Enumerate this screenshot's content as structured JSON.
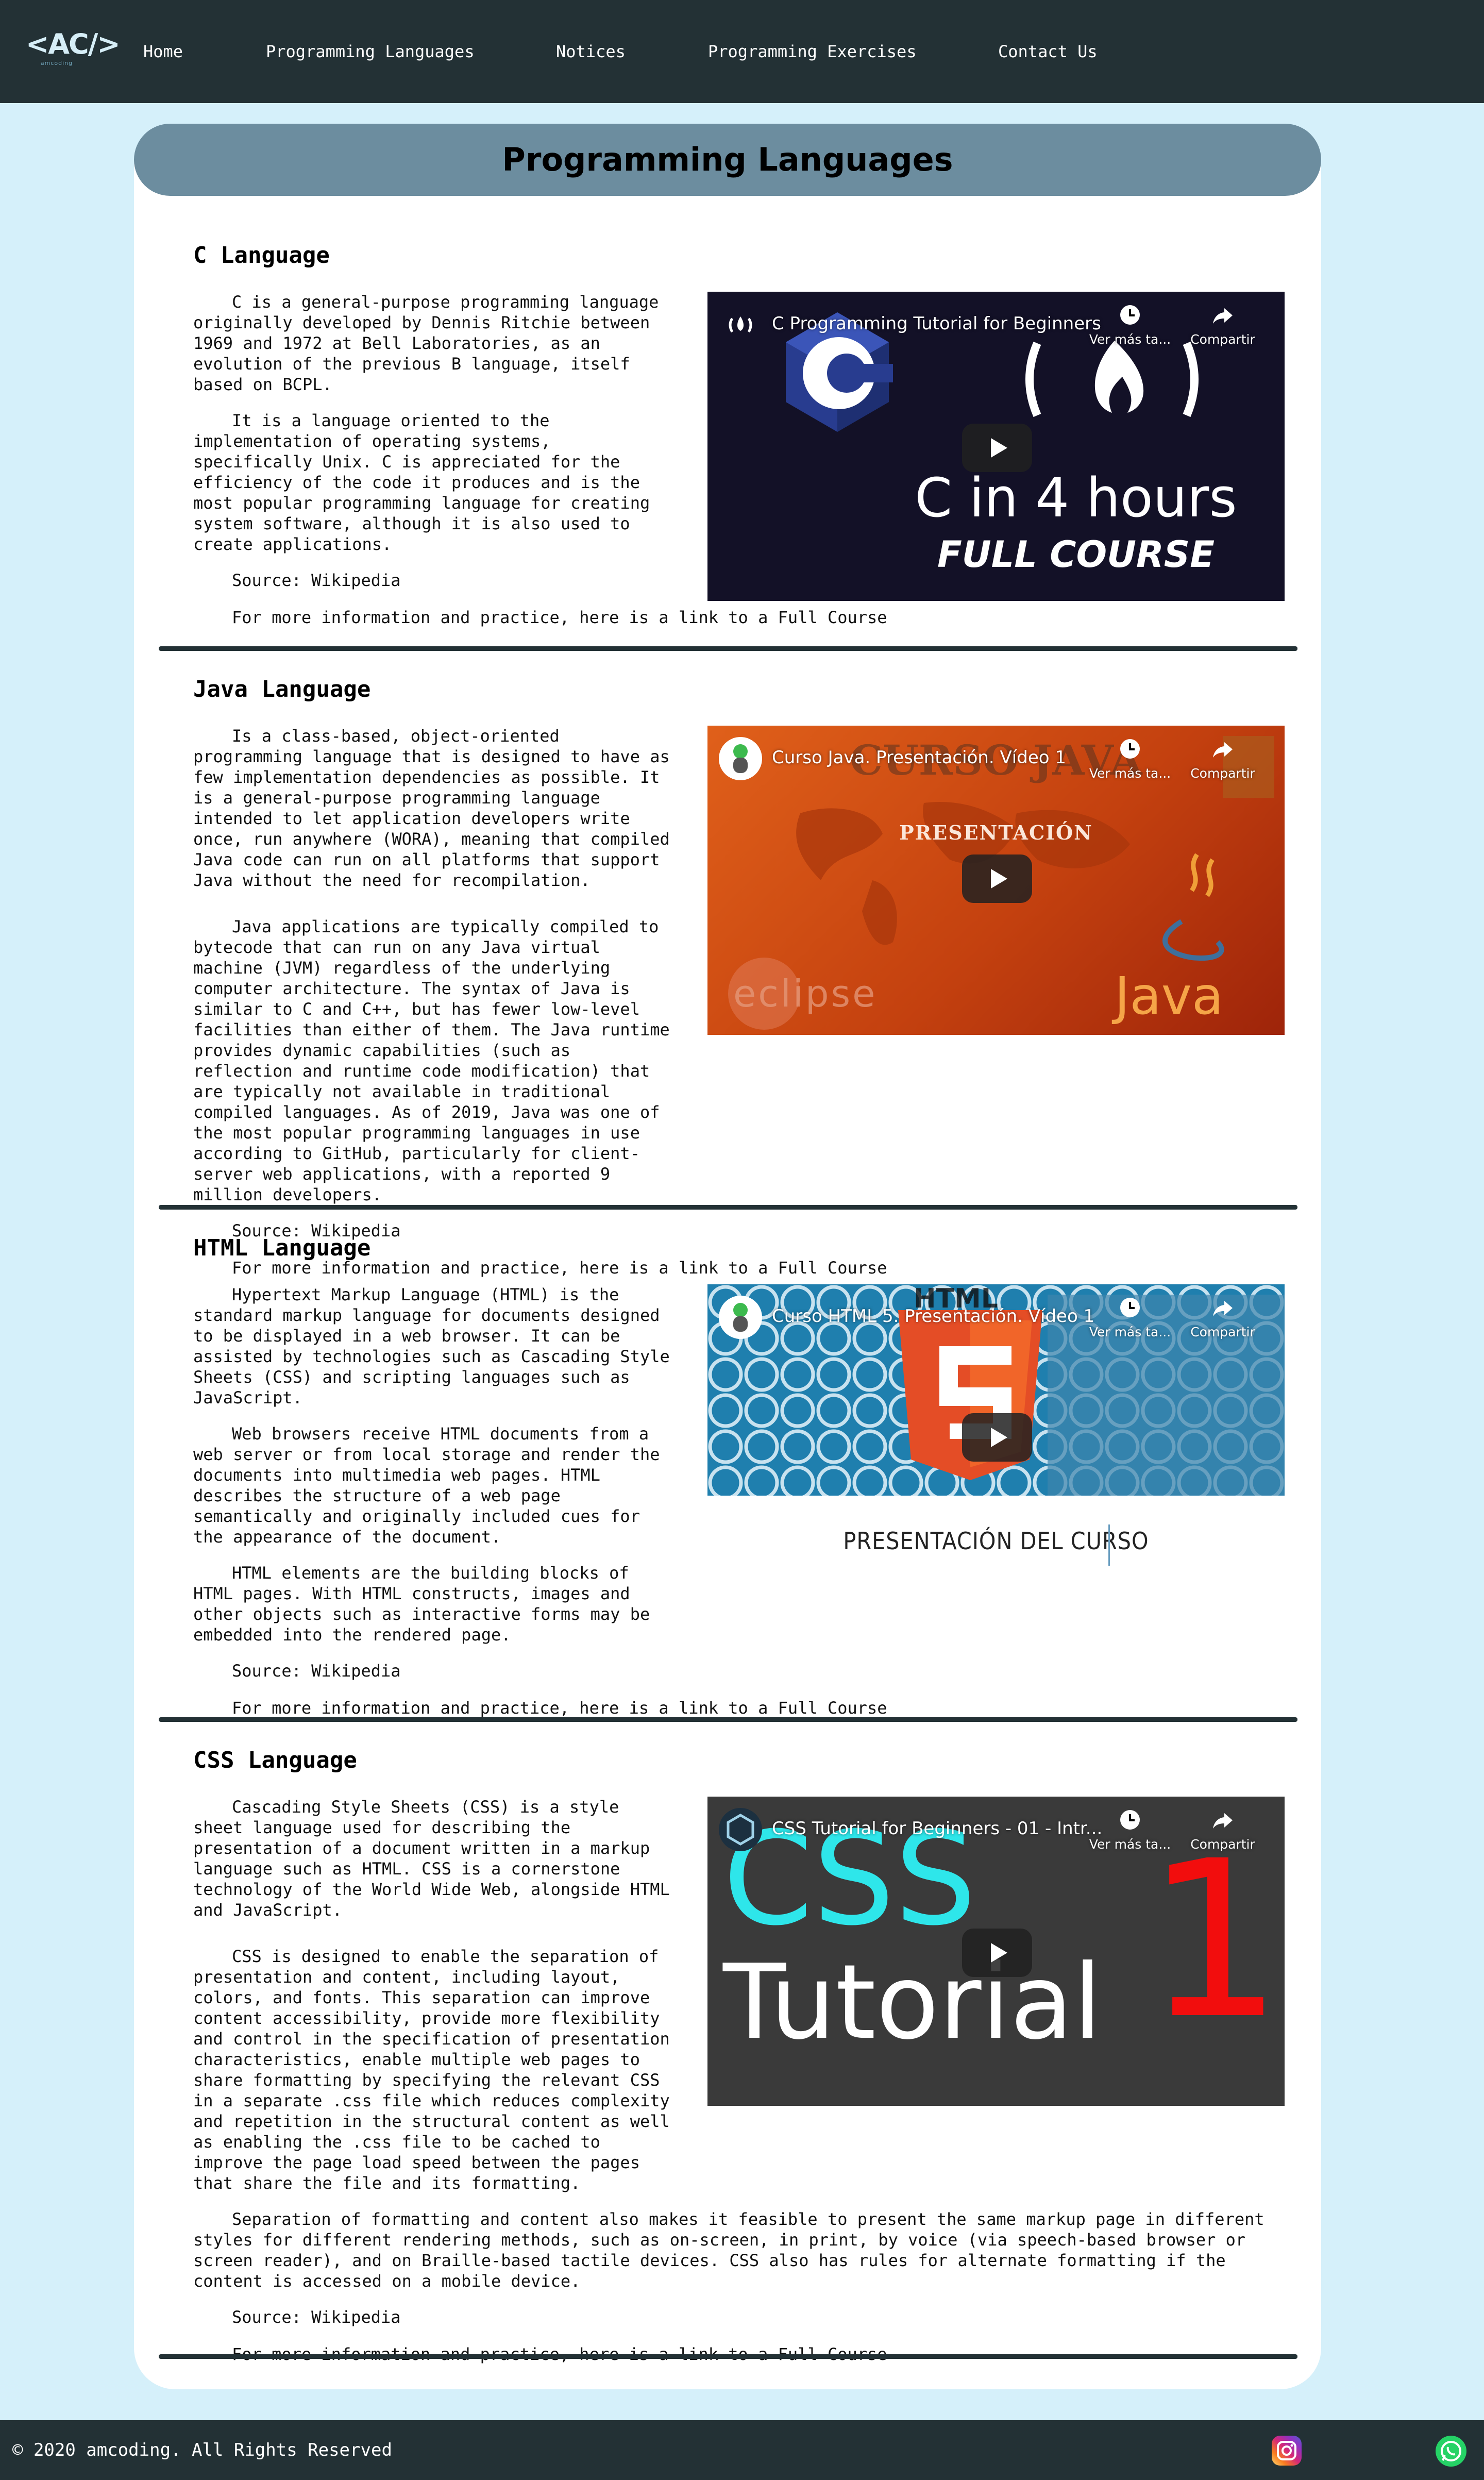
{
  "brand": {
    "logo_text": "<AC/>",
    "logo_sub": "amcoding"
  },
  "nav": {
    "items": [
      {
        "label": "Home"
      },
      {
        "label": "Programming Languages"
      },
      {
        "label": "Notices"
      },
      {
        "label": "Programming Exercises"
      },
      {
        "label": "Contact Us"
      }
    ]
  },
  "page_title": "Programming Languages",
  "sections": [
    {
      "heading": "C Language",
      "paragraphs": [
        "C is a general-purpose programming language originally developed by Dennis Ritchie between 1969 and 1972 at Bell Laboratories, as an evolution of the previous B language, itself based on BCPL.",
        "It is a language oriented to the implementation of operating systems, specifically Unix. C is appreciated for the efficiency of the code it produces and is the most popular programming language for creating system software, although it is also used to create applications."
      ],
      "source": "Source: Wikipedia",
      "more": "For more information and practice, here is a link to a Full Course",
      "video": {
        "title": "C Programming Tutorial for Beginners",
        "watch_later": "Ver más ta...",
        "share": "Compartir",
        "big_text_1": "C in 4 hours",
        "big_text_2": "FULL COURSE",
        "logo_letter": "C"
      }
    },
    {
      "heading": "Java Language",
      "paragraphs": [
        "Is a class-based, object-oriented programming language that is designed to have as few implementation dependencies as possible. It is a general-purpose programming language intended to let application developers write once, run anywhere (WORA), meaning that compiled Java code can run on all platforms that support Java without the need for recompilation.",
        "Java applications are typically compiled to bytecode that can run on any Java virtual machine (JVM) regardless of the underlying computer architecture. The syntax of Java is similar to C and C++, but has fewer low-level facilities than either of them. The Java runtime provides dynamic capabilities (such as reflection and runtime code modification) that are typically not available in traditional compiled languages. As of 2019, Java was one of the most popular programming languages in use according to GitHub, particularly for client-server web applications, with a reported 9 million developers."
      ],
      "source": "Source: Wikipedia",
      "more": "For more information and practice, here is a link to a Full Course",
      "video": {
        "title": "Curso Java. Presentación. Vídeo 1",
        "watch_later": "Ver más ta...",
        "share": "Compartir",
        "banner": "CURSO JAVA",
        "subtitle": "PRESENTACIÓN",
        "eclipse": "eclipse",
        "java_word": "Java"
      }
    },
    {
      "heading": "HTML Language",
      "paragraphs": [
        "Hypertext Markup Language (HTML) is the standard markup language for documents designed to be displayed in a web browser. It can be assisted by technologies such as Cascading Style Sheets (CSS) and scripting languages such as JavaScript.",
        "Web browsers receive HTML documents from a web server or from local storage and render the documents into multimedia web pages. HTML describes the structure of a web page semantically and originally included cues for the appearance of the document.",
        "HTML elements are the building blocks of HTML pages. With HTML constructs, images and other objects such as interactive forms may be embedded into the rendered page."
      ],
      "source": "Source: Wikipedia",
      "more": "For more information and practice, here is a link to a Full Course",
      "video": {
        "title": "Curso HTML 5. Presentación. Vídeo 1",
        "watch_later": "Ver más ta...",
        "share": "Compartir",
        "html_word": "HTML",
        "badge_number": "5",
        "caption": "PRESENTACIÓN DEL CURSO"
      }
    },
    {
      "heading": "CSS Language",
      "paragraphs": [
        "Cascading Style Sheets (CSS) is a style sheet language used for describing the presentation of a document written in a markup language such as HTML. CSS is a cornerstone technology of the World Wide Web, alongside HTML and JavaScript.",
        "CSS is designed to enable the separation of presentation and content, including layout, colors, and fonts. This separation can improve content accessibility, provide more flexibility and control in the specification of presentation characteristics, enable multiple web pages to share formatting by specifying the relevant CSS in a separate .css file which reduces complexity and repetition in the structural content as well as enabling the .css file to be cached to improve the page load speed between the pages that share the file and its formatting.",
        "Separation of formatting and content also makes it feasible to present the same markup page in different styles for different rendering methods, such as on-screen, in print, by voice (via speech-based browser or screen reader), and on Braille-based tactile devices. CSS also has rules for alternate formatting if the content is accessed on a mobile device."
      ],
      "source": "Source: Wikipedia",
      "more": "For more information and practice, here is a link to a Full Course",
      "video": {
        "title": "CSS Tutorial for Beginners - 01 - Intr...",
        "watch_later": "Ver más ta...",
        "share": "Compartir",
        "word_1": "CSS",
        "word_2": "Tutorial",
        "number": "1"
      }
    }
  ],
  "footer": {
    "copyright": "© 2020 amcoding. All Rights Reserved"
  },
  "icons": [
    "instagram-icon",
    "whatsapp-icon",
    "play-icon",
    "clock-icon",
    "share-icon"
  ]
}
